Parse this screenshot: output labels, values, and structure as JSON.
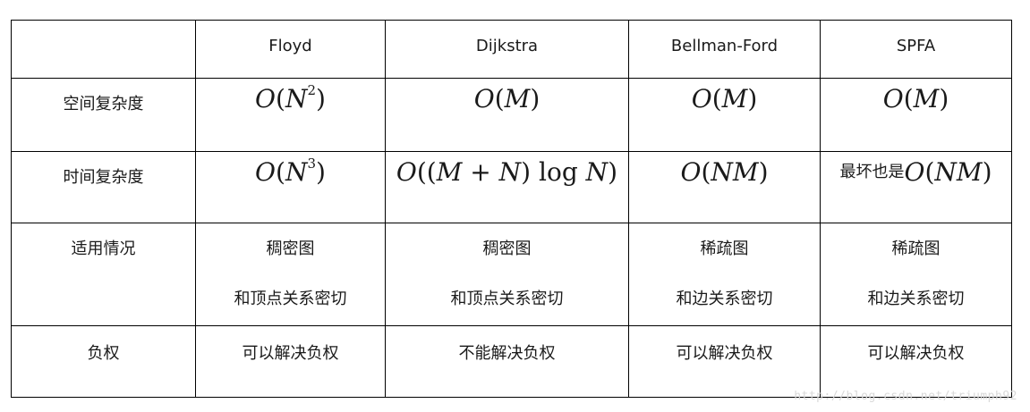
{
  "table": {
    "headers": [
      "",
      "Floyd",
      "Dijkstra",
      "Bellman-Ford",
      "SPFA"
    ],
    "rows": {
      "space": {
        "label": "空间复杂度",
        "floyd": {
          "o": "O",
          "open": "(",
          "var": "N",
          "exp": "2",
          "close": ")"
        },
        "dijkstra": {
          "o": "O",
          "open": "(",
          "var": "M",
          "close": ")"
        },
        "bellman": {
          "o": "O",
          "open": "(",
          "var": "M",
          "close": ")"
        },
        "spfa": {
          "o": "O",
          "open": "(",
          "var": "M",
          "close": ")"
        }
      },
      "time": {
        "label": "时间复杂度",
        "floyd": {
          "o": "O",
          "open": "(",
          "var": "N",
          "exp": "3",
          "close": ")"
        },
        "dijkstra": {
          "o": "O",
          "open": "((",
          "m": "M",
          "plus": " + ",
          "n": "N",
          "close1": ") ",
          "log": "log ",
          "n2": "N",
          "close2": ")"
        },
        "bellman": {
          "o": "O",
          "open": "(",
          "var": "NM",
          "close": ")"
        },
        "spfa": {
          "prefix": "最坏也是",
          "o": "O",
          "open": "(",
          "var": "NM",
          "close": ")"
        }
      },
      "use": {
        "label": "适用情况",
        "floyd": [
          "稠密图",
          "和顶点关系密切"
        ],
        "dijkstra": [
          "稠密图",
          "和顶点关系密切"
        ],
        "bellman": [
          "稀疏图",
          "和边关系密切"
        ],
        "spfa": [
          "稀疏图",
          "和边关系密切"
        ]
      },
      "neg": {
        "label": "负权",
        "floyd": "可以解决负权",
        "dijkstra": "不能解决负权",
        "bellman": "可以解决负权",
        "spfa": "可以解决负权"
      }
    }
  },
  "watermark": "http://blog.csdn.net/triumph92"
}
